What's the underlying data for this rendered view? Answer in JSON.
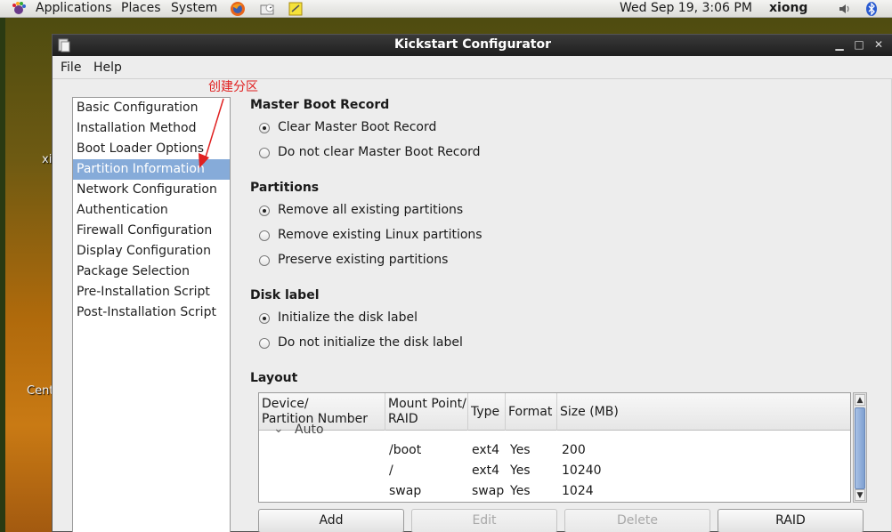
{
  "panel": {
    "applications": "Applications",
    "places": "Places",
    "system": "System",
    "datetime": "Wed Sep 19,  3:06 PM",
    "user": "xiong"
  },
  "desktop": {
    "label1": "xi",
    "label2": "Cent"
  },
  "window": {
    "title": "Kickstart Configurator"
  },
  "menu": {
    "file": "File",
    "help": "Help"
  },
  "annotation": "创建分区",
  "sidebar": {
    "items": [
      {
        "label": "Basic Configuration"
      },
      {
        "label": "Installation Method"
      },
      {
        "label": "Boot Loader Options"
      },
      {
        "label": "Partition Information",
        "selected": true
      },
      {
        "label": "Network Configuration"
      },
      {
        "label": "Authentication"
      },
      {
        "label": "Firewall Configuration"
      },
      {
        "label": "Display Configuration"
      },
      {
        "label": "Package Selection"
      },
      {
        "label": "Pre-Installation Script"
      },
      {
        "label": "Post-Installation Script"
      }
    ]
  },
  "mbr": {
    "title": "Master Boot Record",
    "options": [
      "Clear Master Boot Record",
      "Do not clear Master Boot Record"
    ],
    "selected": 0
  },
  "partitions": {
    "title": "Partitions",
    "options": [
      "Remove all existing partitions",
      "Remove existing Linux partitions",
      "Preserve existing partitions"
    ],
    "selected": 0
  },
  "disklabel": {
    "title": "Disk label",
    "options": [
      "Initialize the disk label",
      "Do not initialize the disk label"
    ],
    "selected": 0
  },
  "layout": {
    "title": "Layout",
    "headers": {
      "device1": "Device/",
      "device2": "Partition Number",
      "mount1": "Mount Point/",
      "mount2": "RAID",
      "type": "Type",
      "format": "Format",
      "size": "Size (MB)"
    },
    "auto": "Auto",
    "rows": [
      {
        "mount": "/boot",
        "type": "ext4",
        "format": "Yes",
        "size": "200"
      },
      {
        "mount": "/",
        "type": "ext4",
        "format": "Yes",
        "size": "10240"
      },
      {
        "mount": "swap",
        "type": "swap",
        "format": "Yes",
        "size": "1024"
      }
    ]
  },
  "buttons": {
    "add": "Add",
    "edit": "Edit",
    "delete": "Delete",
    "raid": "RAID"
  },
  "colors": {
    "selection": "#86abd9",
    "annotation": "#e02020",
    "titlebar": "#2a2a2a"
  }
}
